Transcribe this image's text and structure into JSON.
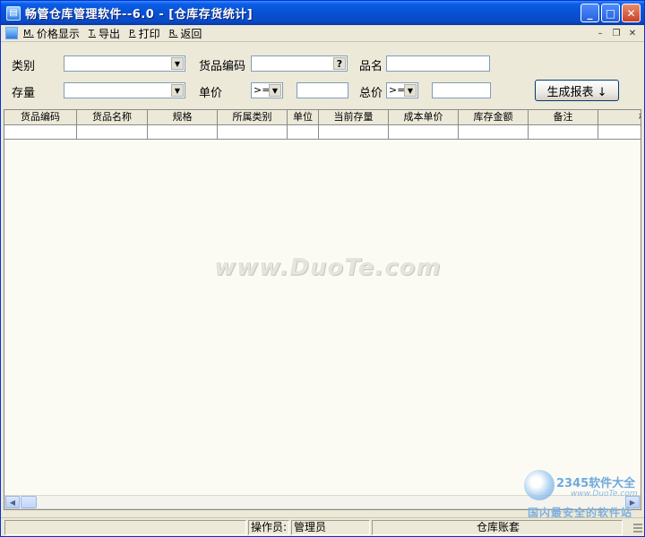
{
  "window": {
    "title": "畅管仓库管理软件--6.0 - [仓库存货统计]"
  },
  "menu": {
    "items": [
      {
        "key": "M.",
        "label": "价格显示"
      },
      {
        "key": "T.",
        "label": "导出"
      },
      {
        "key": "P.",
        "label": "打印"
      },
      {
        "key": "R.",
        "label": "返回"
      }
    ]
  },
  "filters": {
    "category_label": "类别",
    "code_label": "货品编码",
    "code_button": "?",
    "name_label": "品名",
    "stock_label": "存量",
    "price_label": "单价",
    "price_op": ">=",
    "total_label": "总价",
    "total_op": ">=",
    "generate_button": "生成报表 ↓"
  },
  "grid": {
    "columns": [
      "货品编码",
      "货品名称",
      "规格",
      "所属类别",
      "单位",
      "当前存量",
      "成本单价",
      "库存金额",
      "备注",
      "核算"
    ]
  },
  "status": {
    "operator_label": "操作员:",
    "operator_value": "管理员",
    "account": "仓库账套"
  },
  "watermark": {
    "text": "www.DuoTe.com",
    "brand": "2345软件大全",
    "url": "www.DuoTe.com",
    "slogan": "国内最安全的软件站"
  },
  "colors": {
    "titlebar": "#0852D6",
    "face": "#ECE9D8",
    "grid_bg": "#FBFBF4",
    "border": "#7F9DB9"
  }
}
